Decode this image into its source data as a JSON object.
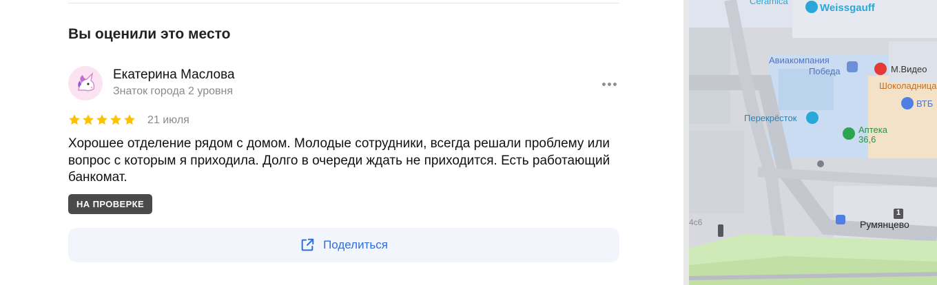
{
  "review_section": {
    "title": "Вы оценили это место",
    "author": {
      "name": "Екатерина Маслова",
      "level": "Знаток города 2 уровня"
    },
    "rating": 5,
    "date": "21 июля",
    "text": "Хорошее отделение рядом с домом. Молодые сотрудники, всегда решали проблему или вопрос с которым я приходила. Долго в очереди ждать не приходится. Есть работающий банкомат.",
    "status": "НА ПРОВЕРКЕ",
    "share_label": "Поделиться"
  },
  "colors": {
    "star": "#fcc200",
    "accent": "#2f6fd9",
    "badge": "#4a4a4a"
  },
  "map": {
    "labels": {
      "ceramica": "Ceramica",
      "weissgauff": "Weissgauff",
      "pobeda_1": "Авиакомпания",
      "pobeda_2": "Победа",
      "mvideo": "М.Видео",
      "shokoladnitsa": "Шоколадница",
      "vtb": "ВТБ",
      "perekrestok": "Перекрёсток",
      "apteka_1": "Аптека",
      "apteka_2": "36,6",
      "building_4c6": "4с6",
      "metro_line": "1",
      "rumyantsevo": "Румянцево"
    }
  }
}
